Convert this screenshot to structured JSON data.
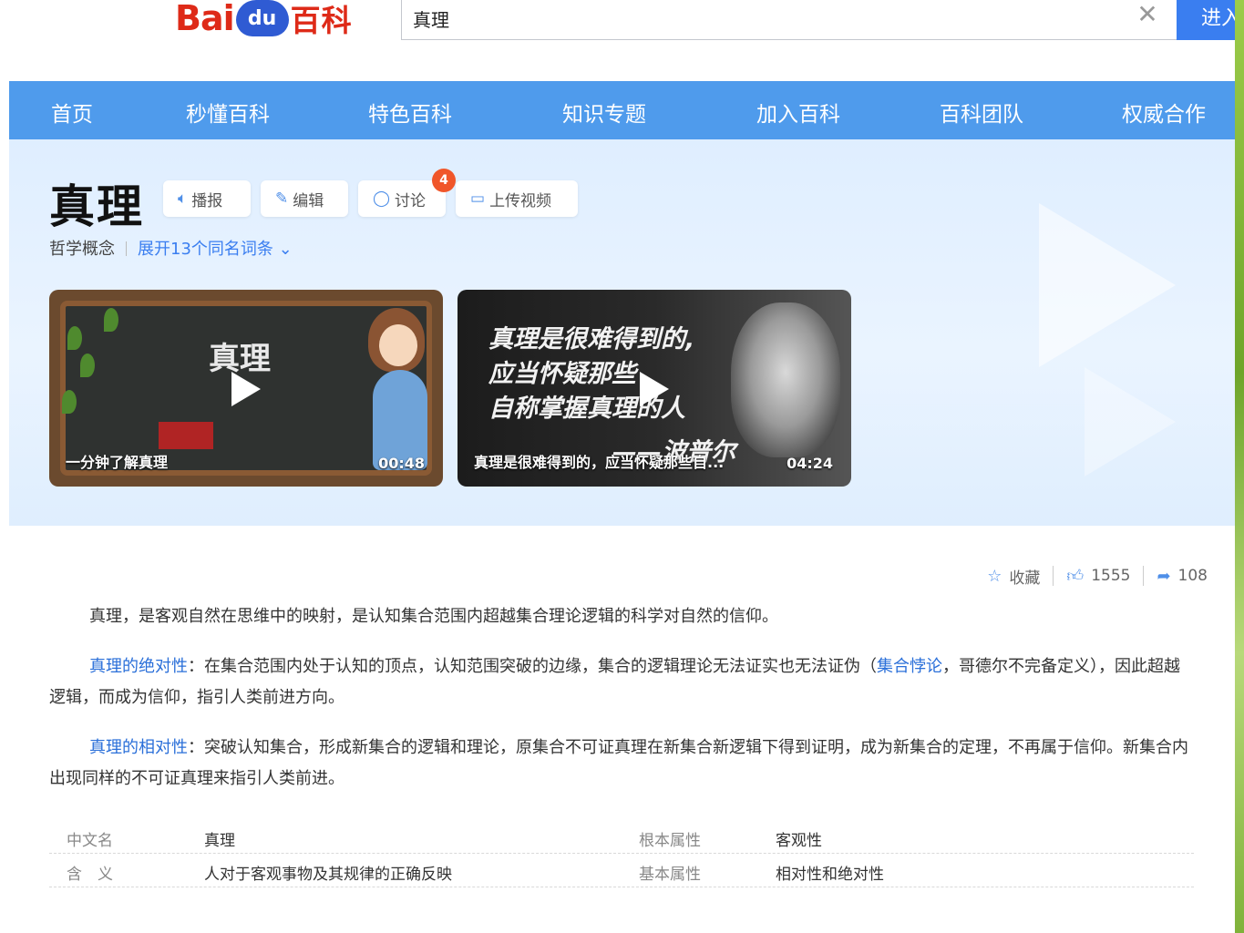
{
  "header": {
    "logo": {
      "bai": "Bai",
      "du": "du",
      "baike": "百科"
    },
    "search_value": "真理",
    "clear_icon": "close-icon",
    "enter_label": "进入"
  },
  "nav": [
    "首页",
    "秒懂百科",
    "特色百科",
    "知识专题",
    "加入百科",
    "百科团队",
    "权威合作"
  ],
  "entry": {
    "title": "真理",
    "tools": [
      {
        "icon": "speaker-icon",
        "label": "播报"
      },
      {
        "icon": "pencil-icon",
        "label": "编辑"
      },
      {
        "icon": "chat-bubble-icon",
        "label": "讨论",
        "badge": "4"
      },
      {
        "icon": "video-camera-icon",
        "label": "上传视频"
      }
    ],
    "category": "哲学概念",
    "expand_label": "展开13个同名词条"
  },
  "videos": [
    {
      "title_on_image": "真理",
      "caption": "一分钟了解真理",
      "duration": "00:48"
    },
    {
      "quote_line1": "真理是很难得到的,",
      "quote_line2": "应当怀疑那些",
      "quote_line3": "自称掌握真理的人",
      "quote_author": "——波普尔",
      "caption": "真理是很难得到的，应当怀疑那些自...",
      "duration": "04:24"
    }
  ],
  "stats": {
    "favorite_label": "收藏",
    "like_count": "1555",
    "share_count": "108"
  },
  "paragraphs": {
    "p1": "真理，是客观自然在思维中的映射，是认知集合范围内超越集合理论逻辑的科学对自然的信仰。",
    "p2_link": "真理的绝对性",
    "p2_a": "：在集合范围内处于认知的顶点，认知范围突破的边缘，集合的逻辑理论无法证实也无法证伪（",
    "p2_link2": "集合悖论",
    "p2_b": "，哥德尔不完备定义），因此超越逻辑，而成为信仰，指引人类前进方向。",
    "p3_link": "真理的相对性",
    "p3_a": "：突破认知集合，形成新集合的逻辑和理论，原集合不可证真理在新集合新逻辑下得到证明，成为新集合的定理，不再属于信仰。新集合内出现同样的不可证真理来指引人类前进。"
  },
  "infobox": [
    {
      "k1": "中文名",
      "v1": "真理",
      "k2": "根本属性",
      "v2": "客观性"
    },
    {
      "k1": "含　义",
      "v1": "人对于客观事物及其规律的正确反映",
      "k2": "基本属性",
      "v2": "相对性和绝对性"
    }
  ]
}
